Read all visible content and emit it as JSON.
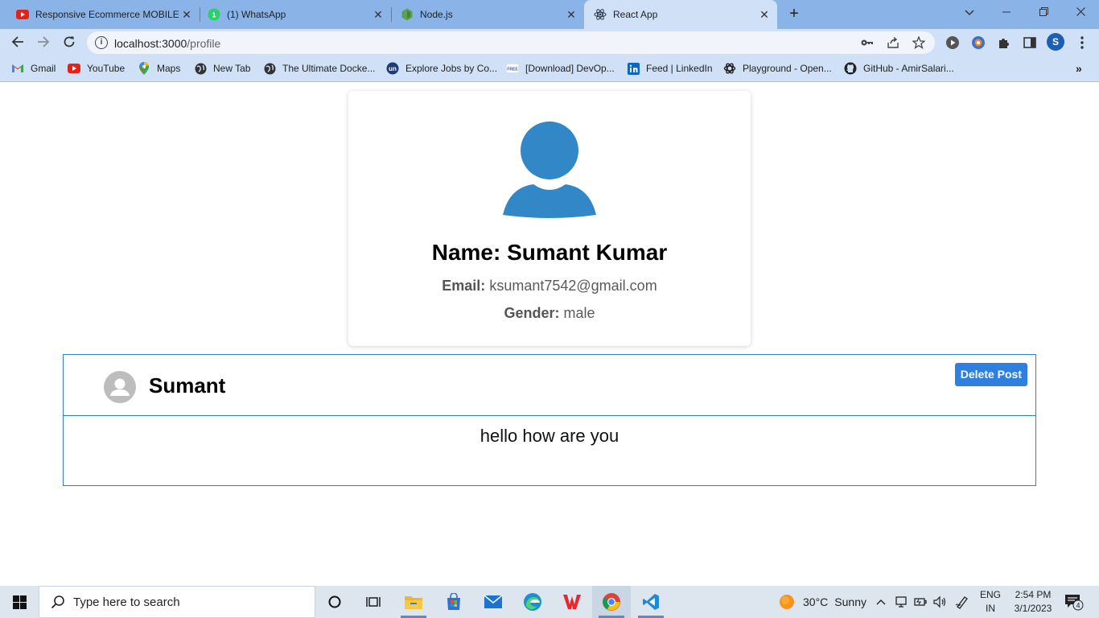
{
  "browser": {
    "tabs": [
      {
        "title": "Responsive Ecommerce MOBILE",
        "icon": "youtube-icon"
      },
      {
        "title": "(1) WhatsApp",
        "icon": "whatsapp-icon"
      },
      {
        "title": "Node.js",
        "icon": "nodejs-icon"
      },
      {
        "title": "React App",
        "icon": "react-icon",
        "active": true
      }
    ],
    "address": {
      "host": "localhost:3000",
      "path": "/profile"
    },
    "bookmarks": [
      {
        "label": "Gmail",
        "icon": "gmail-icon"
      },
      {
        "label": "YouTube",
        "icon": "youtube-icon"
      },
      {
        "label": "Maps",
        "icon": "maps-icon"
      },
      {
        "label": "New Tab",
        "icon": "globe-icon"
      },
      {
        "label": "The Ultimate Docke...",
        "icon": "globe-icon"
      },
      {
        "label": "Explore Jobs by Co...",
        "icon": "un-icon"
      },
      {
        "label": "[Download] DevOp...",
        "icon": "free-icon"
      },
      {
        "label": "Feed | LinkedIn",
        "icon": "linkedin-icon"
      },
      {
        "label": "Playground - Open...",
        "icon": "openai-icon"
      },
      {
        "label": "GitHub - AmirSalari...",
        "icon": "github-icon"
      }
    ],
    "profile_initial": "S"
  },
  "profile": {
    "name_label": "Name:",
    "name": "Sumant Kumar",
    "email_label": "Email:",
    "email": "ksumant7542@gmail.com",
    "gender_label": "Gender:",
    "gender": "male",
    "avatar_color": "#3288c7"
  },
  "post": {
    "author": "Sumant",
    "delete_label": "Delete Post",
    "content": "hello how are you",
    "border_color": "#2f80ce",
    "button_color": "#2f7fe0"
  },
  "taskbar": {
    "search_placeholder": "Type here to search",
    "weather": {
      "temp": "30°C",
      "condition": "Sunny"
    },
    "lang_line1": "ENG",
    "lang_line2": "IN",
    "time": "2:54 PM",
    "date": "3/1/2023",
    "notifications": "4"
  }
}
